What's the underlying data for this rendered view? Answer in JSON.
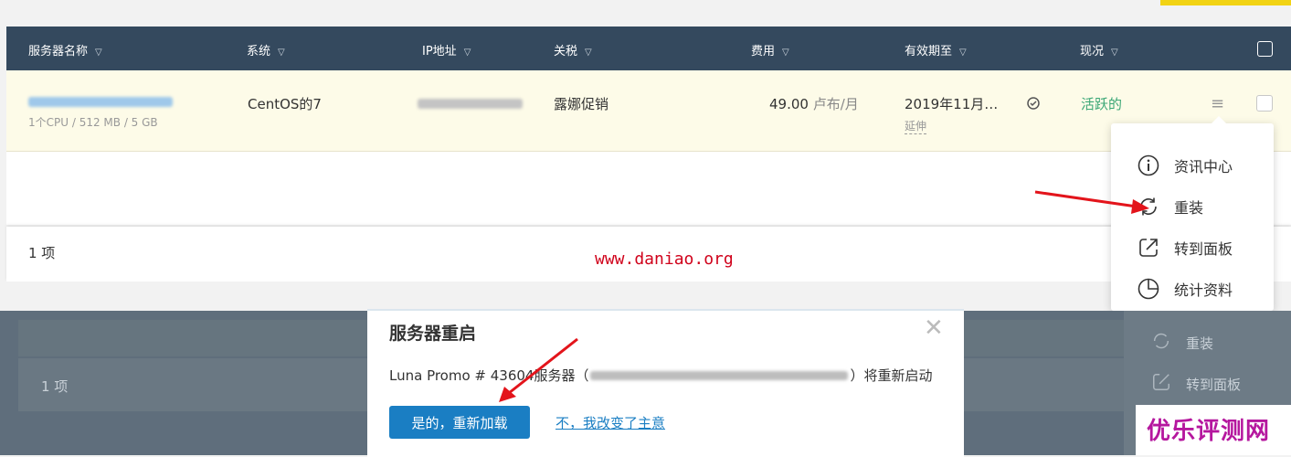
{
  "table": {
    "columns": [
      "服务器名称",
      "系统",
      "IP地址",
      "关税",
      "费用",
      "有效期至",
      "现况"
    ],
    "filter_icon": "filter-icon",
    "row": {
      "server_specs": "1个CPU / 512 MB / 5 GB",
      "os": "CentOS的7",
      "tariff": "露娜促销",
      "fee_amount": "49.00",
      "fee_unit": "卢布/月",
      "expiry": "2019年11月…",
      "extend_label": "延伸",
      "status": "活跃的"
    },
    "footer_count": "1 项"
  },
  "watermark": "www.daniao.org",
  "dropdown": {
    "items": [
      {
        "label": "资讯中心",
        "icon": "info-icon"
      },
      {
        "label": "重装",
        "icon": "refresh-icon"
      },
      {
        "label": "转到面板",
        "icon": "external-panel-icon"
      },
      {
        "label": "统计资料",
        "icon": "pie-chart-icon"
      }
    ]
  },
  "overlay": {
    "footer_count": "1 项",
    "dropdown_items": [
      "重装",
      "转到面板"
    ]
  },
  "modal": {
    "title": "服务器重启",
    "message_prefix": "Luna Promo # 43604服务器（",
    "message_suffix": "）将重新启动",
    "confirm_label": "是的，重新加载",
    "cancel_label": "不，我改变了主意"
  },
  "brand_watermark": "优乐评测网",
  "colors": {
    "header_bg": "#34495e",
    "row_bg": "#fdfbe8",
    "status_green": "#3ba776",
    "primary_blue": "#1a7ec3",
    "arrow_red": "#e3141b"
  }
}
